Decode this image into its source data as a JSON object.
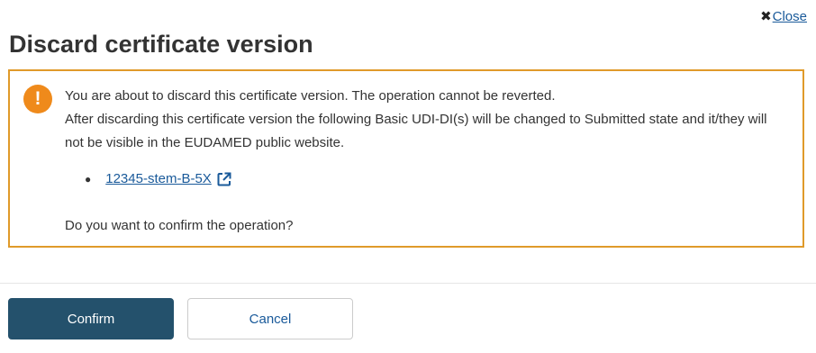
{
  "dialog": {
    "close_label": "Close",
    "title": "Discard certificate version"
  },
  "warning": {
    "line1": "You are about to discard this certificate version. The operation cannot be reverted.",
    "line2": "After discarding this certificate version the following Basic UDI-DI(s) will be changed to Submitted state and it/they will not be visible in the EUDAMED public website.",
    "udi_items": [
      "12345-stem-B-5X"
    ],
    "question": "Do you want to confirm the operation?",
    "icon": "exclamation-icon",
    "color": "#e09a2a"
  },
  "buttons": {
    "confirm": "Confirm",
    "cancel": "Cancel"
  },
  "colors": {
    "primary": "#24516c",
    "link": "#1a5a9a",
    "warning_icon": "#ef8a1b"
  }
}
